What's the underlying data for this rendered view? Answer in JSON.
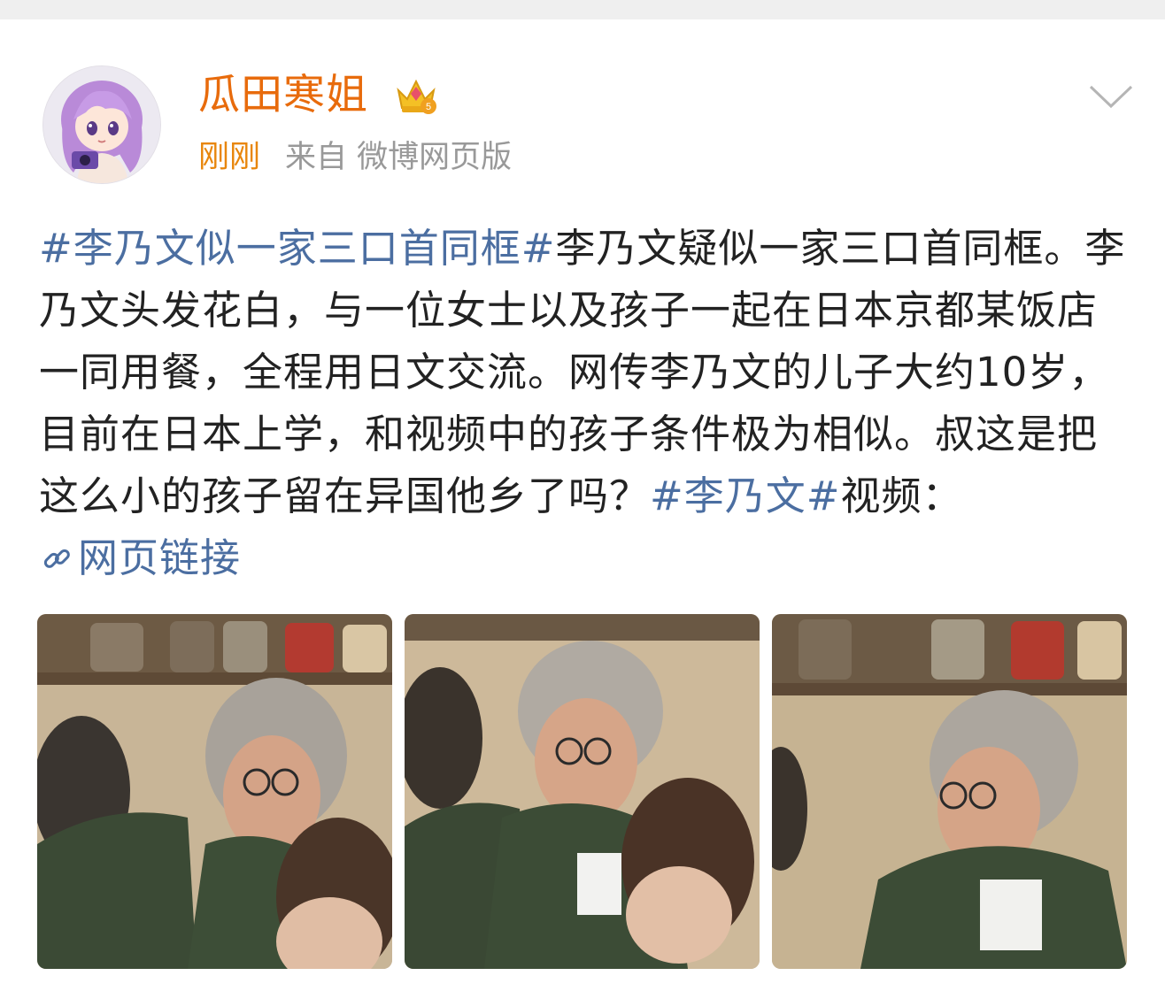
{
  "post": {
    "username": "瓜田寒姐",
    "time": "刚刚",
    "source": "来自 微博网页版",
    "content": [
      {
        "type": "tag",
        "text": "#李乃文似一家三口首同框#"
      },
      {
        "type": "text",
        "text": "李乃文疑似一家三口首同框。李乃文头发花白，与一位女士以及孩子一起在日本京都某饭店一同用餐，全程用日文交流。网传李乃文的儿子大约10岁，目前在日本上学，和视频中的孩子条件极为相似。叔这是把这么小的孩子留在异国他乡了吗？"
      },
      {
        "type": "tag",
        "text": "#李乃文#"
      },
      {
        "type": "text",
        "text": "视频："
      },
      {
        "type": "link",
        "text": "网页链接"
      }
    ],
    "images": [
      {
        "name": "photo-1"
      },
      {
        "name": "photo-2"
      },
      {
        "name": "photo-3"
      }
    ]
  },
  "colors": {
    "username": "#e86b0c",
    "time": "#e8860c",
    "tag": "#4b6ea1",
    "text": "#222222",
    "meta": "#999999"
  },
  "icons": {
    "crown": "vip-crown-icon",
    "chevron": "chevron-down-icon",
    "link": "link-icon"
  }
}
